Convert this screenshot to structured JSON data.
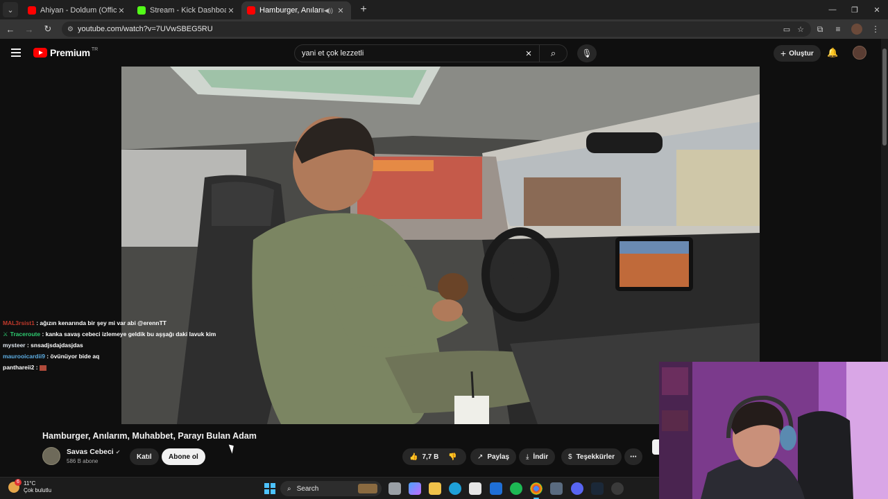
{
  "browser": {
    "tabs": [
      {
        "title": "Ahiyan - Doldum (Official Video",
        "favicon_color": "#ff0000",
        "active": false
      },
      {
        "title": "Stream - Kick Dashboard",
        "favicon_color": "#53fc18",
        "active": false
      },
      {
        "title": "Hamburger, Anılarım, Muha",
        "favicon_color": "#ff0000",
        "active": true
      }
    ],
    "url": "youtube.com/watch?v=7UVwSBEG5RU"
  },
  "youtube": {
    "brand": "Premium",
    "country": "TR",
    "search_query": "yani et çok lezzetli",
    "create_label": "Oluştur"
  },
  "chat": [
    {
      "user": "MAL3rsist1",
      "message": "ağızın kenarında bir şey mi var abi @erennTT",
      "color": "#c0392b"
    },
    {
      "user": "Traceroute",
      "message": "kanka savaş cebeci izlemeye geldik bu aşşağı daki lavuk kim",
      "color": "#2ecc71",
      "badge": "sword-icon"
    },
    {
      "user": "mysteer",
      "message": "snsadjsdajdasjdas",
      "color": "#dfe6ee"
    },
    {
      "user": "maurooicardii9",
      "message": "övünüyor bide aq",
      "color": "#5dade2"
    },
    {
      "user": "panthareii2",
      "message": "",
      "color": "#ffffff",
      "emote": true
    }
  ],
  "video": {
    "title": "Hamburger, Anılarım, Muhabbet, Parayı Bulan Adam",
    "channel": "Savas Cebeci",
    "subscribers": "586 B abone",
    "join_label": "Katıl",
    "subscribe_label": "Abone ol",
    "likes": "7,7 B",
    "share_label": "Paylaş",
    "download_label": "İndir",
    "thanks_label": "Teşekkürler"
  },
  "taskbar": {
    "temperature": "11°C",
    "weather": "Çok bulutlu",
    "weather_badge": "6",
    "search_label": "Search"
  }
}
